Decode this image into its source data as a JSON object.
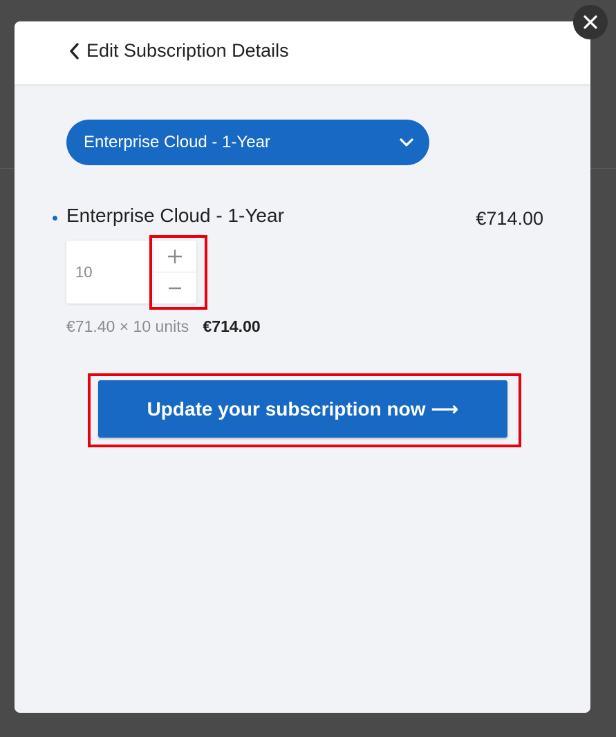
{
  "header": {
    "title": "Edit Subscription Details"
  },
  "plan_select": {
    "selected": "Enterprise Cloud - 1-Year"
  },
  "line_item": {
    "name": "Enterprise Cloud - 1-Year",
    "price": "€714.00",
    "quantity": "10",
    "unit_calc": "€71.40 × 10 units",
    "total": "€714.00"
  },
  "actions": {
    "update_label": "Update your subscription now ⟶"
  },
  "icons": {
    "close": "close-icon",
    "back": "chevron-left-icon",
    "dropdown": "chevron-down-icon",
    "increment": "plus-icon",
    "decrement": "minus-icon"
  },
  "colors": {
    "accent": "#1769c4",
    "highlight": "#e8000b",
    "modal_bg": "#f2f3f7",
    "backdrop": "#4a4a4a"
  }
}
